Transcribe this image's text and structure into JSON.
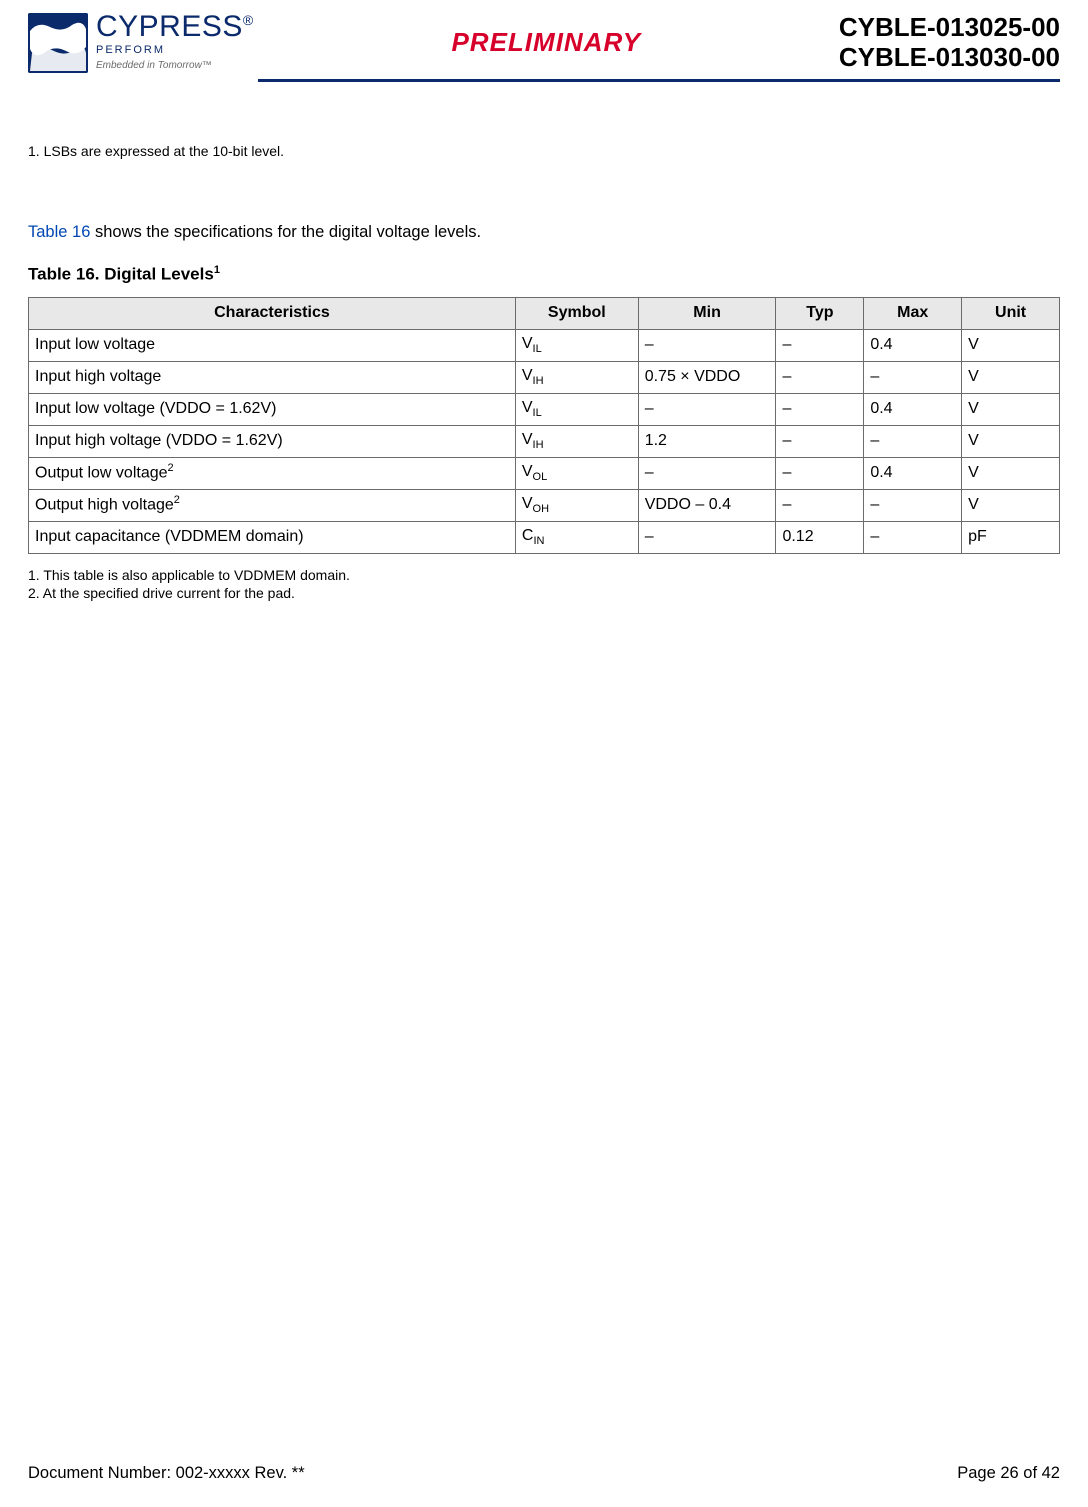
{
  "header": {
    "brand_name": "CYPRESS",
    "brand_perform": "PERFORM",
    "brand_tag": "Embedded in Tomorrow™",
    "preliminary": "PRELIMINARY",
    "part1": "CYBLE-013025-00",
    "part2": "CYBLE-013030-00"
  },
  "top_note": "1. LSBs are expressed at the 10-bit level.",
  "intro_link": "Table 16",
  "intro_rest": " shows the specifications for the digital voltage levels.",
  "caption_prefix": "Table 16.  Digital Levels",
  "caption_sup": "1",
  "columns": {
    "c0": "Characteristics",
    "c1": "Symbol",
    "c2": "Min",
    "c3": "Typ",
    "c4": "Max",
    "c5": "Unit"
  },
  "rows": [
    {
      "char": "Input low voltage",
      "sup": "",
      "sym_b": "V",
      "sym_s": "IL",
      "min": "–",
      "typ": "–",
      "max": "0.4",
      "unit": "V"
    },
    {
      "char": "Input high voltage",
      "sup": "",
      "sym_b": "V",
      "sym_s": "IH",
      "min": "0.75 × VDDO",
      "typ": "–",
      "max": "–",
      "unit": "V"
    },
    {
      "char": "Input low voltage (VDDO = 1.62V)",
      "sup": "",
      "sym_b": "V",
      "sym_s": "IL",
      "min": "–",
      "typ": "–",
      "max": "0.4",
      "unit": "V"
    },
    {
      "char": "Input high voltage (VDDO = 1.62V)",
      "sup": "",
      "sym_b": "V",
      "sym_s": "IH",
      "min": "1.2",
      "typ": "–",
      "max": "–",
      "unit": "V"
    },
    {
      "char": "Output low voltage",
      "sup": "2",
      "sym_b": "V",
      "sym_s": "OL",
      "min": "–",
      "typ": "–",
      "max": "0.4",
      "unit": "V"
    },
    {
      "char": "Output high voltage",
      "sup": "2",
      "sym_b": "V",
      "sym_s": "OH",
      "min": "VDDO – 0.4",
      "typ": "–",
      "max": "–",
      "unit": "V"
    },
    {
      "char": "Input capacitance (VDDMEM domain)",
      "sup": "",
      "sym_b": "C",
      "sym_s": "IN",
      "min": "–",
      "typ": "0.12",
      "max": "–",
      "unit": "pF"
    }
  ],
  "footnotes": {
    "f1": "1. This table is also applicable to VDDMEM domain.",
    "f2": "2. At the specified drive current for the pad."
  },
  "footer": {
    "left": "Document Number: 002-xxxxx Rev. **",
    "right": "Page 26 of 42"
  }
}
